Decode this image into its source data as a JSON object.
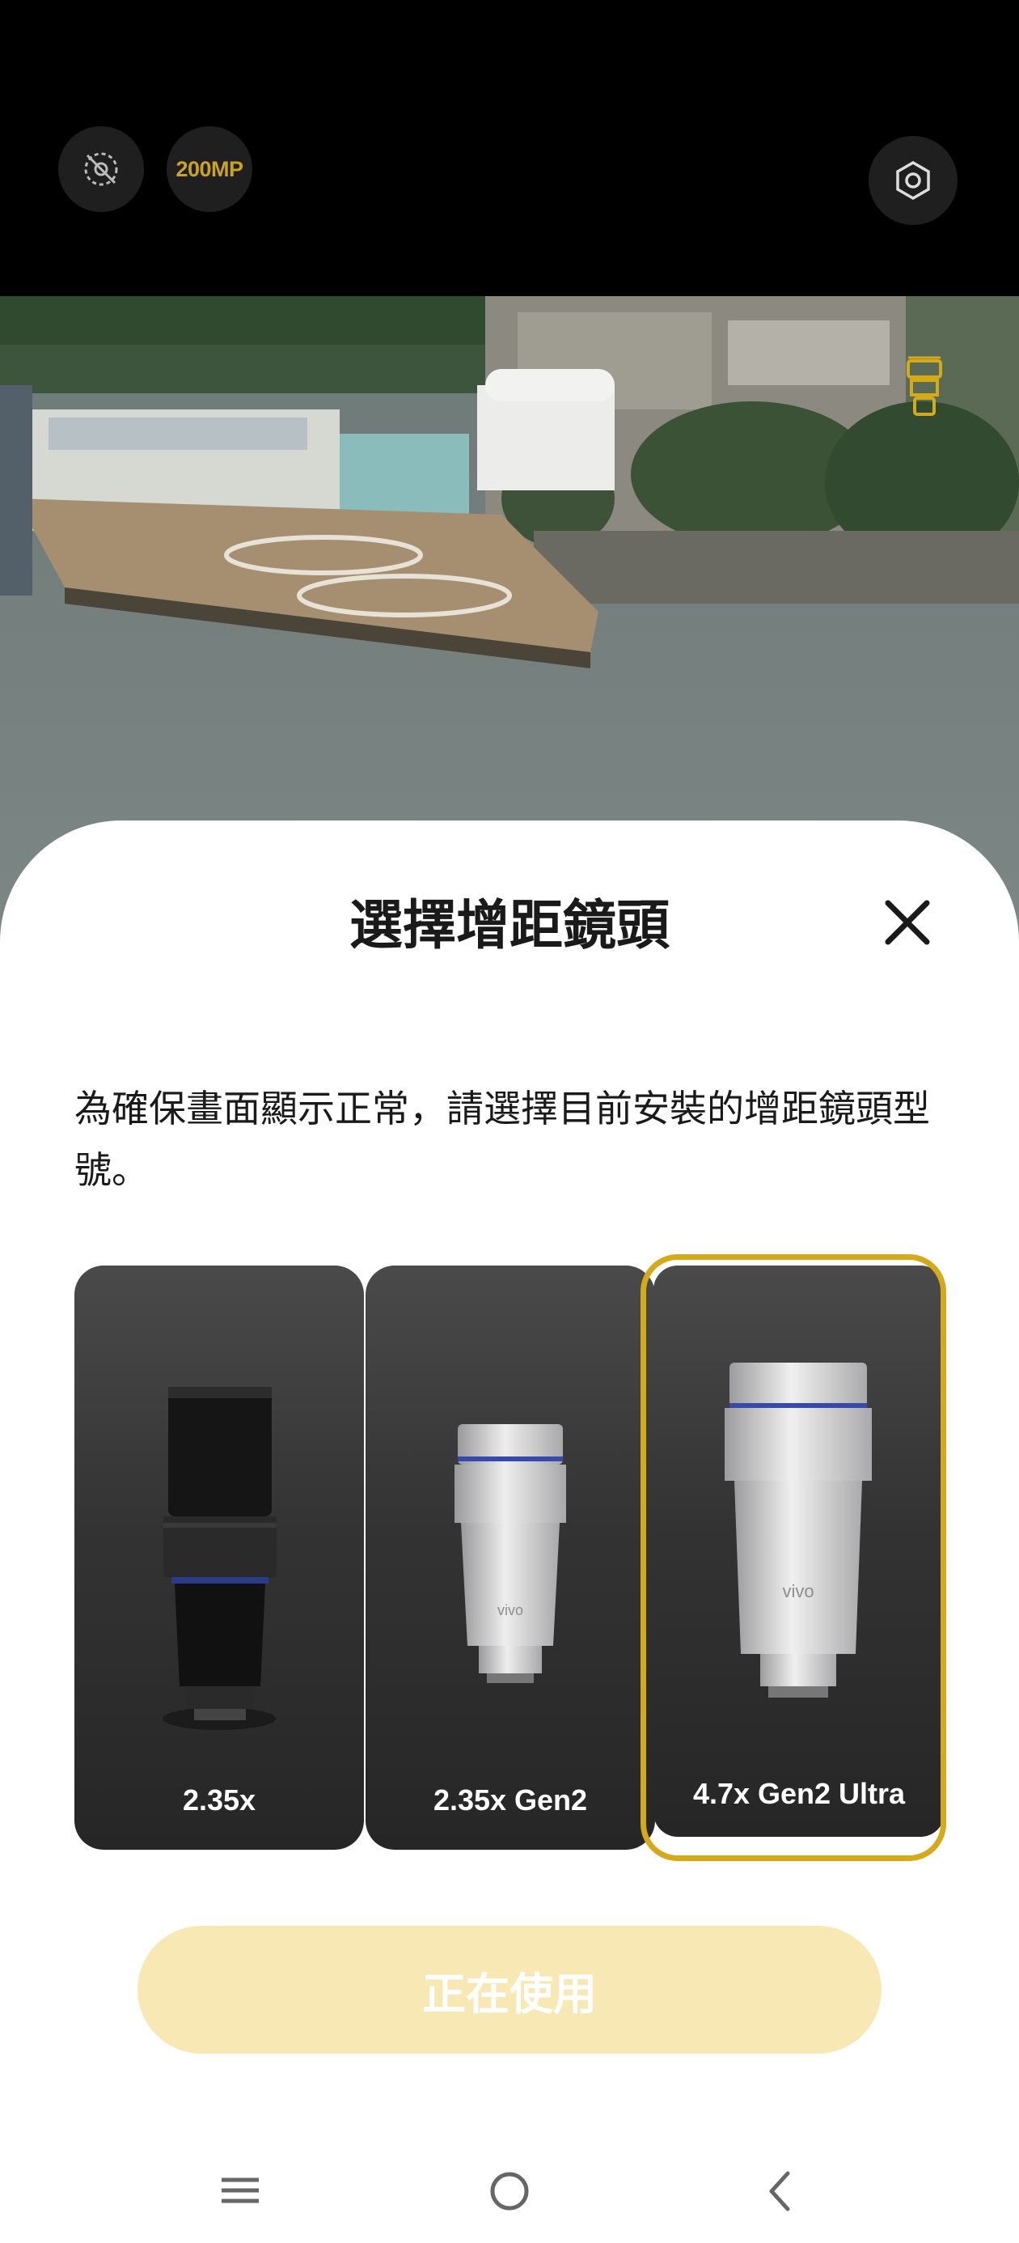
{
  "camera_bar": {
    "mp_label": "200MP",
    "left_icon": "motion-off-icon",
    "right_icon": "hexagon-settings-icon"
  },
  "viewfinder": {
    "lens_icon": "tele-extender-lens-icon",
    "accent": "#d4a91a"
  },
  "sheet": {
    "title": "選擇增距鏡頭",
    "close_icon": "close-icon",
    "description": "為確保畫面顯示正常，請選擇目前安裝的增距鏡頭型號。",
    "lenses": [
      {
        "label": "2.35x",
        "selected": false,
        "image": "black-lens-image"
      },
      {
        "label": "2.35x Gen2",
        "selected": false,
        "image": "silver-lens-image",
        "lens_brand": "vivo"
      },
      {
        "label": "4.7x Gen2 Ultra",
        "selected": true,
        "image": "silver-ultra-lens-image",
        "lens_brand": "vivo"
      }
    ],
    "use_button": "正在使用",
    "colors": {
      "selected_ring": "#d4a91a",
      "button_bg": "#f8e8b4"
    }
  },
  "navbar": {
    "menu_icon": "menu-icon",
    "home_icon": "home-icon",
    "back_icon": "back-icon"
  }
}
